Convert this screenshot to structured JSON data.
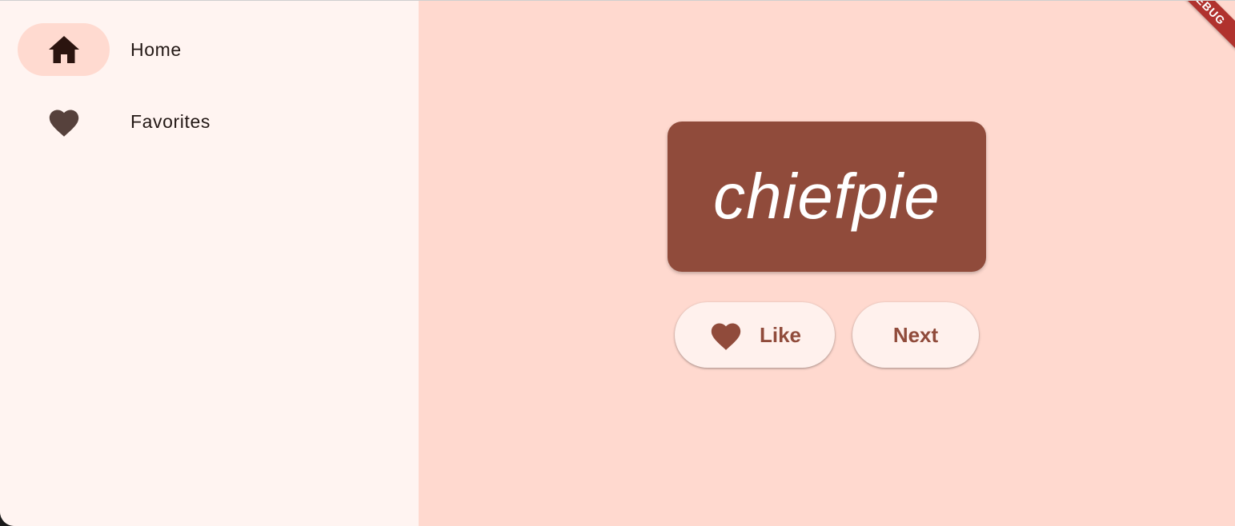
{
  "nav": {
    "items": [
      {
        "label": "Home",
        "icon": "home-icon",
        "selected": true
      },
      {
        "label": "Favorites",
        "icon": "heart-icon",
        "selected": false
      }
    ]
  },
  "main": {
    "word": "chiefpie",
    "like_label": "Like",
    "like_icon": "heart-icon",
    "next_label": "Next"
  },
  "banner": {
    "text": "DEBUG"
  },
  "colors": {
    "rail_background": "#fff4f1",
    "main_background": "#ffd9cf",
    "selected_indicator": "#ffdad0",
    "primary": "#904b3b",
    "button_background": "#fff1ed",
    "nav_text": "#231815",
    "banner": "#b0322e"
  }
}
